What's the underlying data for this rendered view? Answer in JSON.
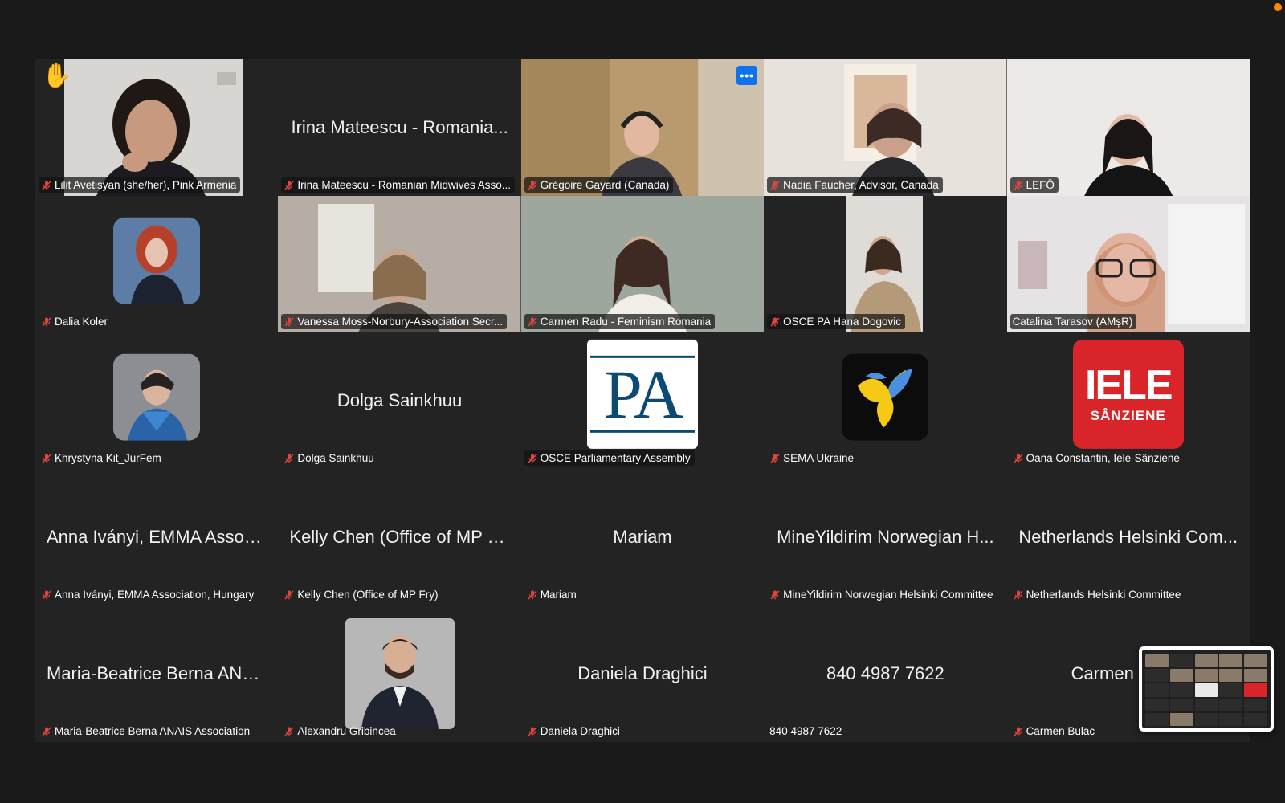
{
  "colors": {
    "background": "#1a1a1a",
    "tile": "#232323",
    "active_speaker": "#23d960",
    "muted_mic": "#e0463f",
    "more_button": "#0e72ed",
    "recording_dot": "#ff8a00"
  },
  "more_button_label": "•••",
  "logos": {
    "pa_text": "PA",
    "iele_big": "IELE",
    "iele_small": "SÂNZIENE"
  },
  "thumbnail": {
    "icon": "self-view-thumbnail"
  },
  "participants": [
    {
      "name": "Lilit Avetisyan (she/her), Pink Armenia",
      "muted": true,
      "kind": "video",
      "raised_hand": true,
      "icon": "raised-hand-icon"
    },
    {
      "name": "Irina Mateescu - Romanian Midwives Asso...",
      "display_name": "Irina Mateescu - Romania...",
      "muted": true,
      "kind": "name"
    },
    {
      "name": "Grégoire Gayard (Canada)",
      "muted": true,
      "kind": "video",
      "more_button": true
    },
    {
      "name": "Nadia Faucher, Advisor, Canada",
      "muted": true,
      "kind": "video"
    },
    {
      "name": "LEFÖ",
      "muted": true,
      "kind": "video"
    },
    {
      "name": "Dalia Koler",
      "muted": true,
      "kind": "avatar"
    },
    {
      "name": "Vanessa Moss-Norbury-Association Secr...",
      "muted": true,
      "kind": "video"
    },
    {
      "name": "Carmen Radu - Feminism Romania",
      "muted": true,
      "kind": "video"
    },
    {
      "name": "OSCE PA Hana Dogovic",
      "muted": true,
      "kind": "video"
    },
    {
      "name": "Catalina Tarasov (AMșR)",
      "muted": false,
      "kind": "video",
      "active": true
    },
    {
      "name": "Khrystyna Kit_JurFem",
      "muted": true,
      "kind": "avatar"
    },
    {
      "name": "Dolga Sainkhuu",
      "display_name": "Dolga Sainkhuu",
      "muted": true,
      "kind": "name"
    },
    {
      "name": "OSCE Parliamentary Assembly",
      "muted": true,
      "kind": "logo-pa"
    },
    {
      "name": "SEMA Ukraine",
      "muted": true,
      "kind": "logo-sema"
    },
    {
      "name": "Oana Constantin, Iele-Sânziene",
      "muted": true,
      "kind": "logo-iele"
    },
    {
      "name": "Anna Iványi, EMMA Association, Hungary",
      "display_name": "Anna Iványi, EMMA Associ...",
      "muted": true,
      "kind": "name"
    },
    {
      "name": "Kelly Chen (Office of MP Fry)",
      "display_name": "Kelly Chen (Office of MP F...",
      "muted": true,
      "kind": "name"
    },
    {
      "name": "Mariam",
      "display_name": "Mariam",
      "muted": true,
      "kind": "name"
    },
    {
      "name": "MineYildirim Norwegian Helsinki Committee",
      "display_name": "MineYildirim Norwegian H...",
      "muted": true,
      "kind": "name"
    },
    {
      "name": "Netherlands Helsinki Committee",
      "display_name": "Netherlands Helsinki Com...",
      "muted": true,
      "kind": "name"
    },
    {
      "name": "Maria-Beatrice Berna ANAIS Association",
      "display_name": "Maria-Beatrice Berna ANA...",
      "muted": true,
      "kind": "name"
    },
    {
      "name": "Alexandru Gribincea",
      "muted": true,
      "kind": "avatar-square"
    },
    {
      "name": "Daniela Draghici",
      "display_name": "Daniela Draghici",
      "muted": true,
      "kind": "name"
    },
    {
      "name": "840 4987 7622",
      "display_name": "840 4987 7622",
      "muted": false,
      "kind": "name"
    },
    {
      "name": "Carmen Bulac",
      "display_name": "Carmen",
      "muted": true,
      "kind": "name"
    }
  ]
}
